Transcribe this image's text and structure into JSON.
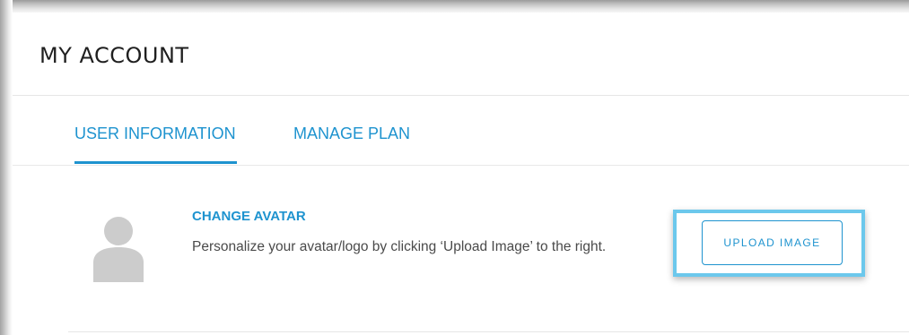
{
  "header": {
    "title": "MY ACCOUNT"
  },
  "tabs": [
    {
      "label": "USER INFORMATION",
      "active": true
    },
    {
      "label": "MANAGE PLAN",
      "active": false
    }
  ],
  "avatar_section": {
    "title": "CHANGE AVATAR",
    "description": "Personalize your avatar/logo by clicking ‘Upload Image’ to the right.",
    "upload_button_label": "UPLOAD IMAGE",
    "avatar_icon": "user-silhouette-icon"
  },
  "colors": {
    "accent": "#1e93cf",
    "highlight": "#6cc8ec",
    "avatar": "#cccccc",
    "title_text": "#1f1f1f",
    "body_text": "#4a4a4a"
  }
}
